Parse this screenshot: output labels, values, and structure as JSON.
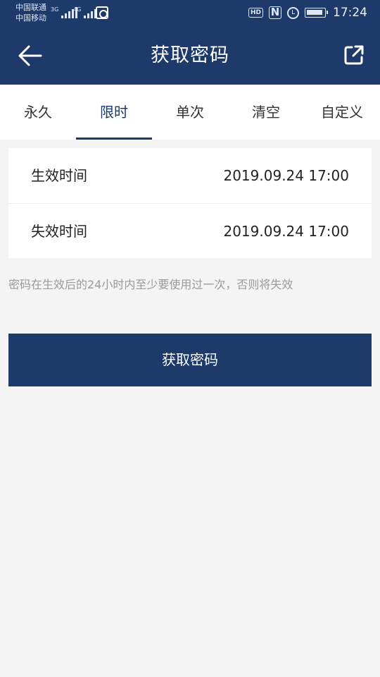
{
  "status_bar": {
    "carrier_1": "中国联通",
    "carrier_2": "中国移动",
    "network_1": "3G",
    "network_2": "4G",
    "hd": "HD",
    "nfc": "N",
    "time": "17:24"
  },
  "header": {
    "title": "获取密码",
    "back_icon": "arrow-left-icon",
    "share_icon": "external-link-icon"
  },
  "tabs": [
    {
      "label": "永久",
      "active": false
    },
    {
      "label": "限时",
      "active": true
    },
    {
      "label": "单次",
      "active": false
    },
    {
      "label": "清空",
      "active": false
    },
    {
      "label": "自定义",
      "active": false
    }
  ],
  "form": {
    "start_label": "生效时间",
    "start_value": "2019.09.24 17:00",
    "end_label": "失效时间",
    "end_value": "2019.09.24 17:00"
  },
  "hint": "密码在生效后的24小时内至少要使用过一次，否则将失效",
  "submit_label": "获取密码",
  "colors": {
    "primary": "#1d3a6b",
    "background": "#f4f4f4",
    "hint": "#9a9a9a"
  }
}
